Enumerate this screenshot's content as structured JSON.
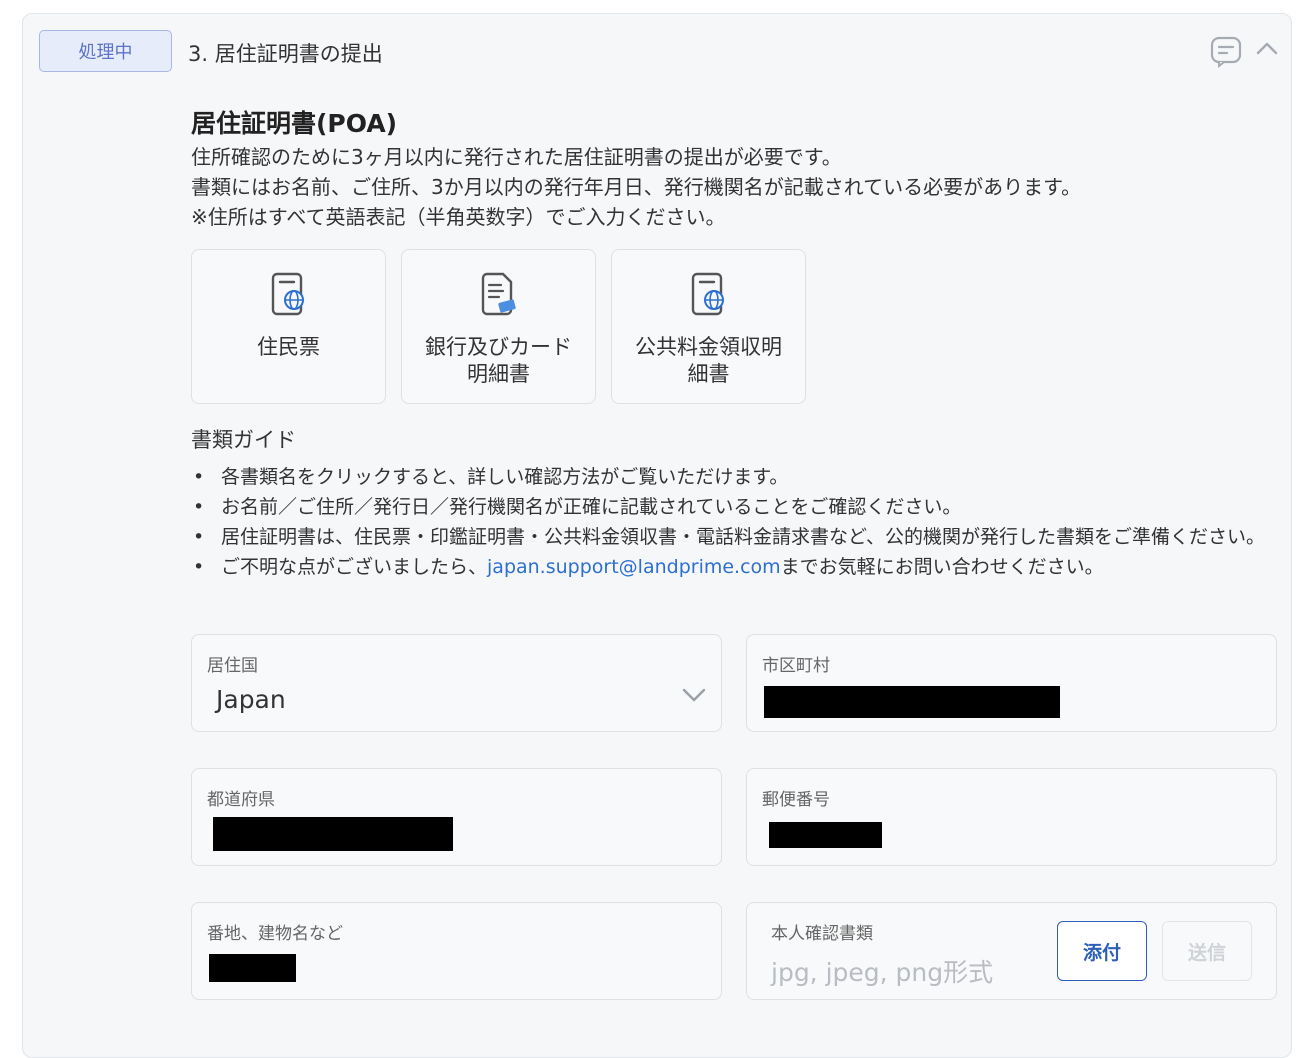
{
  "header": {
    "status_badge": "処理中",
    "step_title": "3. 居住証明書の提出",
    "icons": [
      "comment-icon",
      "chevron-up-icon"
    ]
  },
  "poa": {
    "title": "居住証明書(POA)",
    "desc_lines": [
      "住所確認のために3ヶ月以内に発行された居住証明書の提出が必要です。",
      "書類にはお名前、ご住所、3か月以内の発行年月日、発行機関名が記載されている必要があります。",
      "※住所はすべて英語表記（半角英数字）でご入力ください。"
    ]
  },
  "doc_cards": [
    {
      "label_1": "住民票",
      "label_2": "",
      "icon": "globe-document-icon"
    },
    {
      "label_1": "銀行及びカード",
      "label_2": "明細書",
      "icon": "card-document-icon"
    },
    {
      "label_1": "公共料金領収明",
      "label_2": "細書",
      "icon": "globe-document-icon"
    }
  ],
  "guide": {
    "title": "書類ガイド",
    "items": [
      "各書類名をクリックすると、詳しい確認方法がご覧いただけます。",
      "お名前／ご住所／発行日／発行機関名が正確に記載されていることをご確認ください。",
      "居住証明書は、住民票・印鑑証明書・公共料金領収書・電話料金請求書など、公的機関が発行した書類をご準備ください。"
    ],
    "last_item_prefix": "ご不明な点がございましたら、",
    "email": "japan.support@landprime.com",
    "last_item_suffix": "までお気軽にお問い合わせください。"
  },
  "form": {
    "country_label": "居住国",
    "country_value": "Japan",
    "city_label": "市区町村",
    "prefecture_label": "都道府県",
    "postal_label": "郵便番号",
    "address_label": "番地、建物名など",
    "id_doc_label": "本人確認書類",
    "id_doc_placeholder": "jpg, jpeg, png形式",
    "attach_button": "添付",
    "send_button": "送信"
  },
  "colors": {
    "accent": "#2d5fb8",
    "link": "#2d6fd1",
    "badge_bg": "#e7ecfb",
    "badge_text": "#5b74c7"
  }
}
